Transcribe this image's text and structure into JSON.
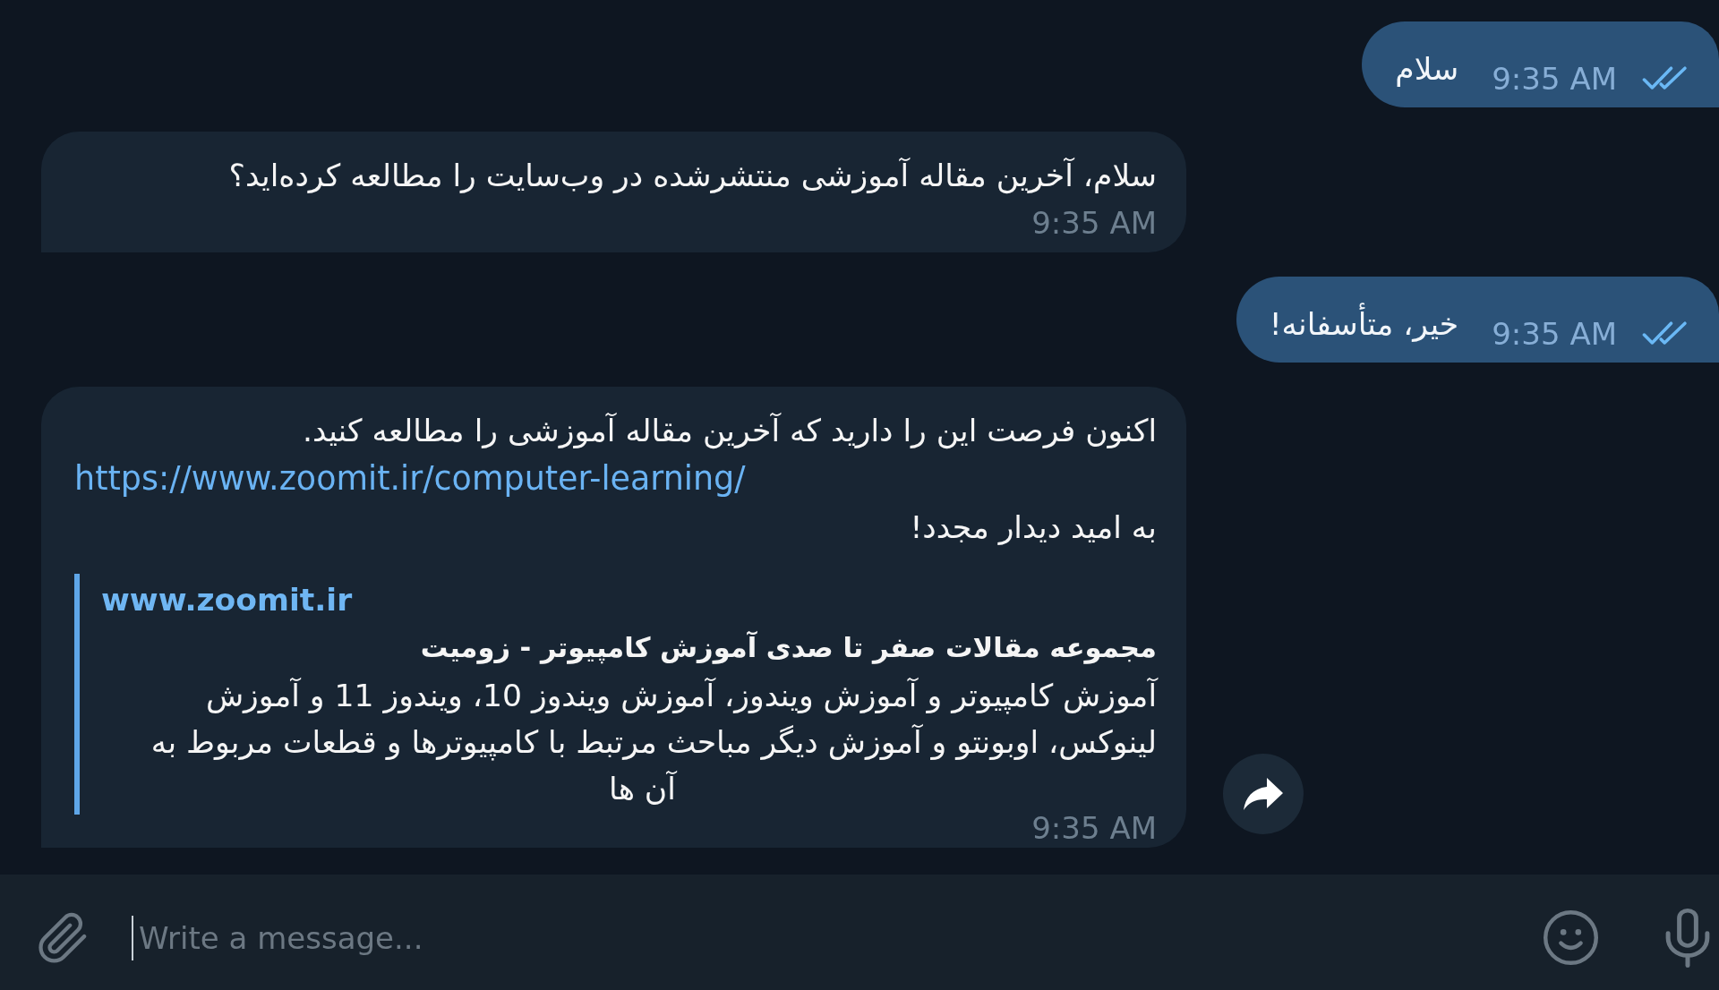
{
  "messages": [
    {
      "kind": "outgoing",
      "text": "سلام",
      "time": "9:35 AM",
      "read": true,
      "forward_button": false
    },
    {
      "kind": "incoming",
      "paragraphs": [
        {
          "kind": "text",
          "text": "سلام، آخرین مقاله آموزشی منتشرشده در وب‌سایت را مطالعه کرده‌اید؟"
        }
      ],
      "time": "9:35 AM",
      "forward_button": false
    },
    {
      "kind": "outgoing",
      "text": "خیر، متأسفانه!",
      "time": "9:35 AM",
      "read": true,
      "forward_button": false
    },
    {
      "kind": "incoming",
      "paragraphs": [
        {
          "kind": "text",
          "text": "اکنون فرصت این را دارید که آخرین مقاله آموزشی را مطالعه کنید."
        },
        {
          "kind": "link",
          "text": "https://www.zoomit.ir/computer-learning/"
        },
        {
          "kind": "text",
          "text": "به امید دیدار مجدد!"
        }
      ],
      "link_preview": {
        "site": "www.zoomit.ir",
        "title": "مجموعه مقالات صفر تا صدی آموزش کامپیوتر - زومیت",
        "description": "آموزش کامپیوتر و آموزش ویندوز، آموزش ویندوز 10، ویندوز 11 و آموزش لینوکس، اوبونتو و آموزش دیگر مباحث مرتبط با کامپیوترها و قطعات مربوط به آن ها"
      },
      "time": "9:35 AM",
      "forward_button": true
    }
  ],
  "composer": {
    "placeholder": "Write a message..."
  }
}
